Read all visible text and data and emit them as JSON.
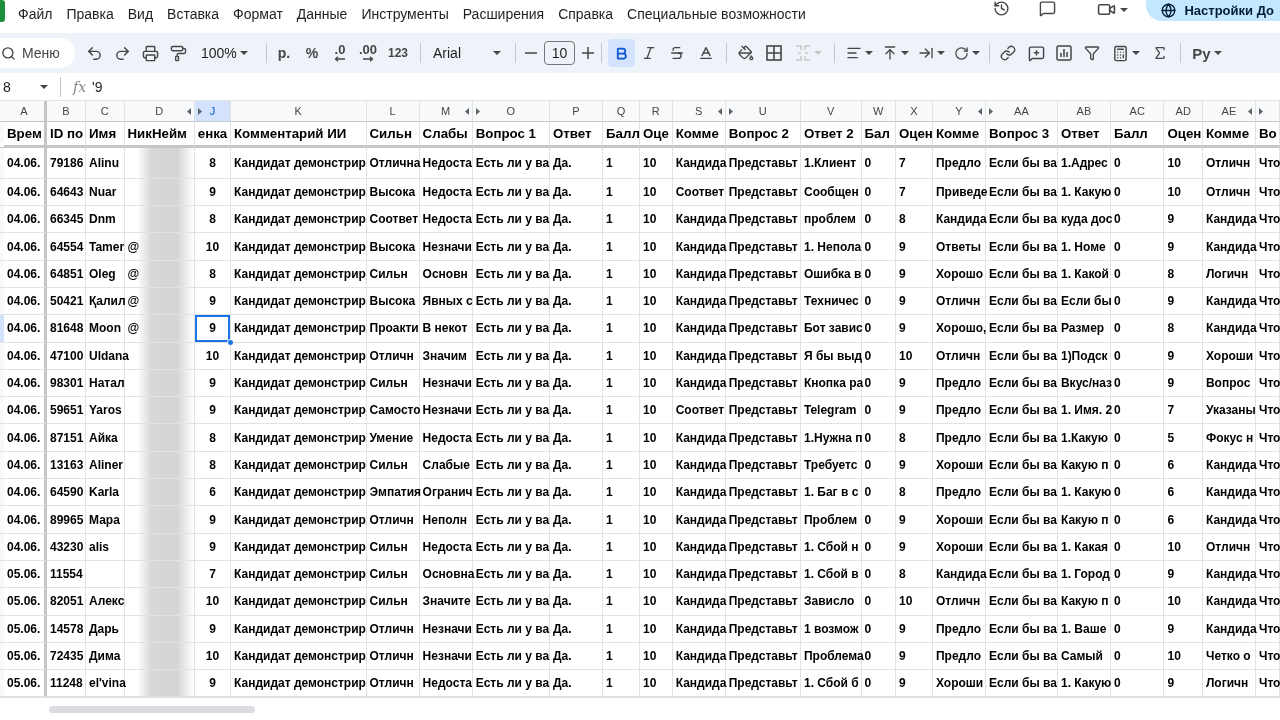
{
  "menu": [
    "Файл",
    "Правка",
    "Вид",
    "Вставка",
    "Формат",
    "Данные",
    "Инструменты",
    "Расширения",
    "Справка",
    "Специальные возможности"
  ],
  "share_button": "Настройки До",
  "toolbar": {
    "search": {
      "placeholder": "Меню"
    },
    "zoom": "100%",
    "number_formats": [
      {
        "label": "р.",
        "kind": "plain"
      },
      {
        "label": "%",
        "kind": "plain"
      },
      {
        "label": ".0",
        "kind": "decrease"
      },
      {
        "label": ".00",
        "kind": "increase"
      },
      {
        "label": "123",
        "kind": "plain"
      }
    ],
    "font": "Arial",
    "font_size": "10",
    "bold": true,
    "italic": false,
    "strikethrough": false,
    "merge_disabled": true,
    "input_tools": "Ру"
  },
  "formula_bar": {
    "cell_ref": "8",
    "function_label": "fx",
    "formula": "'9"
  },
  "table": {
    "columns": [
      {
        "letter": "A",
        "title": "Врем",
        "kind": "text",
        "selected": false,
        "hidden_before": false,
        "hidden_after": false,
        "redacted": false
      },
      {
        "letter": "B",
        "title": "ID по",
        "kind": "text",
        "selected": false,
        "hidden_before": false,
        "hidden_after": false,
        "redacted": false
      },
      {
        "letter": "C",
        "title": "Имя",
        "kind": "text",
        "selected": false,
        "hidden_before": false,
        "hidden_after": false,
        "redacted": false
      },
      {
        "letter": "D",
        "title": "НикНейм",
        "kind": "text",
        "selected": false,
        "hidden_before": false,
        "hidden_after": true,
        "redacted": true
      },
      {
        "letter": "J",
        "title": "енка",
        "kind": "centered",
        "selected": true,
        "hidden_before": true,
        "hidden_after": false,
        "redacted": false
      },
      {
        "letter": "K",
        "title": "Комментарий ИИ",
        "kind": "text",
        "selected": false,
        "hidden_before": false,
        "hidden_after": false,
        "redacted": false
      },
      {
        "letter": "L",
        "title": "Сильн",
        "kind": "text",
        "selected": false,
        "hidden_before": false,
        "hidden_after": false,
        "redacted": false
      },
      {
        "letter": "M",
        "title": "Слабы",
        "kind": "text",
        "selected": false,
        "hidden_before": false,
        "hidden_after": true,
        "redacted": false
      },
      {
        "letter": "O",
        "title": "Вопрос 1",
        "kind": "text",
        "selected": false,
        "hidden_before": true,
        "hidden_after": false,
        "redacted": false
      },
      {
        "letter": "P",
        "title": "Ответ",
        "kind": "text",
        "selected": false,
        "hidden_before": false,
        "hidden_after": false,
        "redacted": false
      },
      {
        "letter": "Q",
        "title": "Балл",
        "kind": "text",
        "selected": false,
        "hidden_before": false,
        "hidden_after": false,
        "redacted": false
      },
      {
        "letter": "R",
        "title": "Оце",
        "kind": "text",
        "selected": false,
        "hidden_before": false,
        "hidden_after": false,
        "redacted": false
      },
      {
        "letter": "S",
        "title": "Комме",
        "kind": "text",
        "selected": false,
        "hidden_before": false,
        "hidden_after": true,
        "redacted": false
      },
      {
        "letter": "U",
        "title": "Вопрос 2",
        "kind": "text",
        "selected": false,
        "hidden_before": true,
        "hidden_after": false,
        "redacted": false
      },
      {
        "letter": "V",
        "title": "Ответ 2",
        "kind": "text",
        "selected": false,
        "hidden_before": false,
        "hidden_after": false,
        "redacted": false
      },
      {
        "letter": "W",
        "title": "Бал",
        "kind": "text",
        "selected": false,
        "hidden_before": false,
        "hidden_after": false,
        "redacted": false
      },
      {
        "letter": "X",
        "title": "Оцен",
        "kind": "text",
        "selected": false,
        "hidden_before": false,
        "hidden_after": false,
        "redacted": false
      },
      {
        "letter": "Y",
        "title": "Комме",
        "kind": "text",
        "selected": false,
        "hidden_before": false,
        "hidden_after": true,
        "redacted": false
      },
      {
        "letter": "AA",
        "title": "Вопрос 3",
        "kind": "text",
        "selected": false,
        "hidden_before": true,
        "hidden_after": false,
        "redacted": false
      },
      {
        "letter": "AB",
        "title": "Ответ",
        "kind": "text",
        "selected": false,
        "hidden_before": false,
        "hidden_after": false,
        "redacted": false
      },
      {
        "letter": "AC",
        "title": "Балл",
        "kind": "text",
        "selected": false,
        "hidden_before": false,
        "hidden_after": false,
        "redacted": false
      },
      {
        "letter": "AD",
        "title": "Оцен",
        "kind": "text",
        "selected": false,
        "hidden_before": false,
        "hidden_after": false,
        "redacted": false
      },
      {
        "letter": "AE",
        "title": "Комме",
        "kind": "text",
        "selected": false,
        "hidden_before": false,
        "hidden_after": true,
        "redacted": false
      },
      {
        "title": "Во",
        "kind": "text",
        "selected": false,
        "hidden_before": true,
        "hidden_after": false,
        "redacted": false
      }
    ],
    "rows": [
      {
        "selected": false,
        "cells": [
          "04.06.",
          "79186",
          "Alinu",
          null,
          "8",
          "Кандидат демонстрир",
          "Отлична",
          "Недоста",
          "Есть ли у ва",
          "Да.",
          "1",
          "10",
          "Кандида",
          "Представьт",
          "1.Клиент",
          "0",
          "7",
          "Предло",
          "Если бы ва",
          "1.Адрес",
          "0",
          "10",
          "Отличн",
          "Что"
        ]
      },
      {
        "selected": false,
        "cells": [
          "04.06.",
          "64643",
          "Nuar",
          null,
          "9",
          "Кандидат демонстрир",
          "Высока",
          "Недоста",
          "Есть ли у ва",
          "Да.",
          "1",
          "10",
          "Соответ",
          "Представьт",
          "Сообщен",
          "0",
          "7",
          "Приведе",
          "Если бы ва",
          "1. Какую",
          "0",
          "10",
          "Отличн",
          "Что"
        ]
      },
      {
        "selected": false,
        "cells": [
          "04.06.",
          "66345",
          "Dnm",
          null,
          "8",
          "Кандидат демонстрир",
          "Соответ",
          "Недоста",
          "Есть ли у ва",
          "Да.",
          "1",
          "10",
          "Кандида",
          "Представьт",
          "проблем",
          "0",
          "8",
          "Кандида",
          "Если бы ва",
          "куда дос",
          "0",
          "9",
          "Кандида",
          "Что"
        ]
      },
      {
        "selected": false,
        "cells": [
          "04.06.",
          "64554",
          "Tamer",
          "@",
          "10",
          "Кандидат демонстрир",
          "Высока",
          "Незначи",
          "Есть ли у ва",
          "Да.",
          "1",
          "10",
          "Кандида",
          "Представьт",
          "1. Непола",
          "0",
          "9",
          "Ответы",
          "Если бы ва",
          "1. Номе",
          "0",
          "9",
          "Кандида",
          "Что"
        ]
      },
      {
        "selected": false,
        "cells": [
          "04.06.",
          "64851",
          "Oleg",
          "@",
          "8",
          "Кандидат демонстрир",
          "Сильн",
          "Основн",
          "Есть ли у ва",
          "Да.",
          "1",
          "10",
          "Кандида",
          "Представьт",
          "Ошибка в",
          "0",
          "9",
          "Хорошо",
          "Если бы ва",
          "1. Какой",
          "0",
          "8",
          "Логичн",
          "Что"
        ]
      },
      {
        "selected": false,
        "cells": [
          "04.06.",
          "50421",
          "Қалил",
          "@",
          "9",
          "Кандидат демонстрир",
          "Высока",
          "Явных с",
          "Есть ли у ва",
          "Да.",
          "1",
          "10",
          "Кандида",
          "Представьт",
          "Техничес",
          "0",
          "9",
          "Отличн",
          "Если бы ва",
          "Если бы",
          "0",
          "9",
          "Кандида",
          "Что"
        ]
      },
      {
        "selected": true,
        "cells": [
          "04.06.",
          "81648",
          "Moon",
          "@",
          "9",
          "Кандидат демонстрир",
          "Проакти",
          "В некот",
          "Есть ли у ва",
          "Да.",
          "1",
          "10",
          "Кандида",
          "Представьт",
          "Бот завис",
          "0",
          "9",
          "Хорошо,",
          "Если бы ва",
          "Размер",
          "0",
          "8",
          "Кандида",
          "Что"
        ]
      },
      {
        "selected": false,
        "cells": [
          "04.06.",
          "47100",
          "Uldana",
          null,
          "10",
          "Кандидат демонстрир",
          "Отличн",
          "Значим",
          "Есть ли у ва",
          "Да.",
          "1",
          "10",
          "Кандида",
          "Представьт",
          "Я бы выд",
          "0",
          "10",
          "Отличн",
          "Если бы ва",
          "1)Подск",
          "0",
          "9",
          "Хороши",
          "Что"
        ]
      },
      {
        "selected": false,
        "cells": [
          "04.06.",
          "98301",
          "Натал",
          null,
          "9",
          "Кандидат демонстрир",
          "Сильн",
          "Незначи",
          "Есть ли у ва",
          "Да.",
          "1",
          "10",
          "Кандида",
          "Представьт",
          "Кнопка ра",
          "0",
          "9",
          "Предло",
          "Если бы ва",
          "Вкус/наз",
          "0",
          "9",
          "Вопрос",
          "Что"
        ]
      },
      {
        "selected": false,
        "cells": [
          "04.06.",
          "59651",
          "Yaros",
          null,
          "9",
          "Кандидат демонстрир",
          "Самосто",
          "Незначи",
          "Есть ли у ва",
          "Да.",
          "1",
          "10",
          "Соответ",
          "Представьт",
          "Telegram",
          "0",
          "9",
          "Предло",
          "Если бы ва",
          "1. Имя. 2",
          "0",
          "7",
          "Указаны",
          "Что"
        ]
      },
      {
        "selected": false,
        "cells": [
          "04.06.",
          "87151",
          "Айка",
          null,
          "8",
          "Кандидат демонстрир",
          "Умение",
          "Недоста",
          "Есть ли у ва",
          "Да.",
          "1",
          "10",
          "Кандида",
          "Представьт",
          "1.Нужна п",
          "0",
          "8",
          "Предло",
          "Если бы ва",
          "1.Какую",
          "0",
          "5",
          "Фокус н",
          "Что"
        ]
      },
      {
        "selected": false,
        "cells": [
          "04.06.",
          "13163",
          "Aliner",
          null,
          "8",
          "Кандидат демонстрир",
          "Сильн",
          "Слабые",
          "Есть ли у ва",
          "Да.",
          "1",
          "10",
          "Кандида",
          "Представьт",
          "Требуетс",
          "0",
          "9",
          "Хороши",
          "Если бы ва",
          "Какую п",
          "0",
          "6",
          "Кандида",
          "Что"
        ]
      },
      {
        "selected": false,
        "cells": [
          "04.06.",
          "64590",
          "Karla",
          null,
          "6",
          "Кандидат демонстрир",
          "Эмпатия",
          "Огранич",
          "Есть ли у ва",
          "Да.",
          "1",
          "10",
          "Кандида",
          "Представьт",
          "1. Баг в с",
          "0",
          "8",
          "Предло",
          "Если бы ва",
          "1. Какую",
          "0",
          "6",
          "Кандида",
          "Что"
        ]
      },
      {
        "selected": false,
        "cells": [
          "04.06.",
          "89965",
          "Мара",
          null,
          "9",
          "Кандидат демонстрир",
          "Отличн",
          "Неполн",
          "Есть ли у ва",
          "Да.",
          "1",
          "10",
          "Кандида",
          "Представьт",
          "Проблем",
          "0",
          "9",
          "Хороши",
          "Если бы ва",
          "Какую п",
          "0",
          "6",
          "Кандида",
          "Что"
        ]
      },
      {
        "selected": false,
        "cells": [
          "04.06.",
          "43230",
          "alis",
          null,
          "9",
          "Кандидат демонстрир",
          "Сильн",
          "Недоста",
          "Есть ли у ва",
          "Да.",
          "1",
          "10",
          "Кандида",
          "Представьт",
          "1. Сбой н",
          "0",
          "9",
          "Хороши",
          "Если бы ва",
          "1. Какая",
          "0",
          "10",
          "Отличн",
          "Что"
        ]
      },
      {
        "selected": false,
        "cells": [
          "05.06.",
          "11554",
          null,
          null,
          "7",
          "Кандидат демонстрир",
          "Сильн",
          "Основна",
          "Есть ли у ва",
          "Да.",
          "1",
          "10",
          "Кандида",
          "Представьт",
          "1. Сбой в",
          "0",
          "8",
          "Кандида",
          "Если бы ва",
          "1. Город",
          "0",
          "9",
          "Кандида",
          "Что"
        ]
      },
      {
        "selected": false,
        "cells": [
          "05.06.",
          "82051",
          "Алекс",
          null,
          "10",
          "Кандидат демонстрир",
          "Сильн",
          "Значите",
          "Есть ли у ва",
          "Да.",
          "1",
          "10",
          "Кандида",
          "Представьт",
          "Зависло",
          "0",
          "10",
          "Отличн",
          "Если бы ва",
          "Какую п",
          "0",
          "10",
          "Кандида",
          "Что"
        ]
      },
      {
        "selected": false,
        "cells": [
          "05.06.",
          "14578",
          "Дарь",
          null,
          "9",
          "Кандидат демонстрир",
          "Отличн",
          "Незначи",
          "Есть ли у ва",
          "Да.",
          "1",
          "10",
          "Кандида",
          "Представьт",
          "1 возмож",
          "0",
          "9",
          "Предло",
          "Если бы ва",
          "1. Ваше",
          "0",
          "9",
          "Кандида",
          "Что"
        ]
      },
      {
        "selected": false,
        "cells": [
          "05.06.",
          "72435",
          "Дима",
          null,
          "10",
          "Кандидат демонстрир",
          "Отличн",
          "Незначи",
          "Есть ли у ва",
          "Да.",
          "1",
          "10",
          "Кандида",
          "Представьт",
          "Проблема",
          "0",
          "9",
          "Предло",
          "Если бы ва",
          "Самый",
          "0",
          "10",
          "Четко о",
          "Что"
        ]
      },
      {
        "selected": false,
        "cells": [
          "05.06.",
          "11248",
          "el'vina",
          null,
          "9",
          "Кандидат демонстрир",
          "Отличн",
          "Недоста",
          "Есть ли у ва",
          "Да.",
          "1",
          "10",
          "Кандида",
          "Представьт",
          "1. Сбой б",
          "0",
          "9",
          "Хороши",
          "Если бы ва",
          "1. Какую",
          "0",
          "9",
          "Логичн",
          "Что"
        ]
      }
    ]
  }
}
